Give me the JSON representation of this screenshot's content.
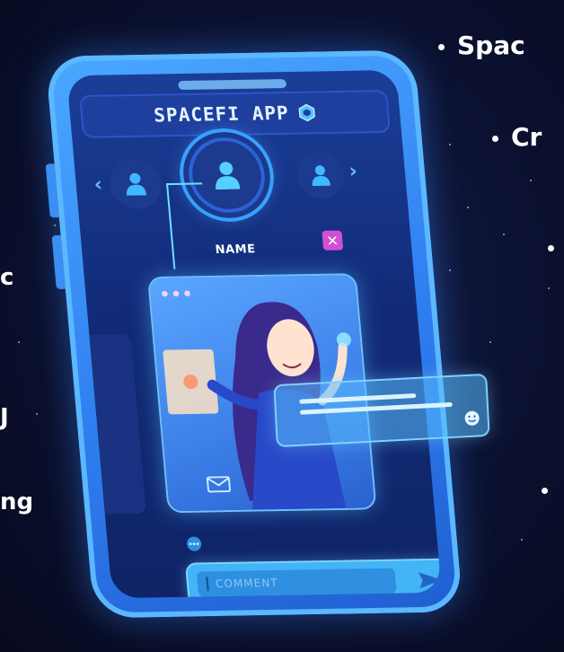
{
  "app": {
    "title": "SPACEFI APP"
  },
  "profile": {
    "name_label": "NAME",
    "close_symbol": "✕"
  },
  "card": {
    "menu_dots": "•••"
  },
  "comment": {
    "placeholder": "COMMENT"
  },
  "background_text": {
    "top_right_1": "Spac",
    "top_right_2": "Cr",
    "left_1": "c",
    "left_2": "J",
    "left_3": "ng"
  },
  "icons": {
    "hex": "hexagon-icon",
    "user": "user-icon",
    "prev": "chevron-left-icon",
    "next": "chevron-right-icon",
    "close": "close-icon",
    "mail": "mail-icon",
    "chat": "chat-icon",
    "send": "send-icon",
    "home": "home-icon",
    "smile": "smile-icon"
  },
  "colors": {
    "background": "#0c1233",
    "phone_frame": "#3b8ff0",
    "screen": "#132e7c",
    "accent_cyan": "#6fe0ff",
    "close_button": "#d14fd0",
    "nav_dot": "#ff7fc6"
  }
}
